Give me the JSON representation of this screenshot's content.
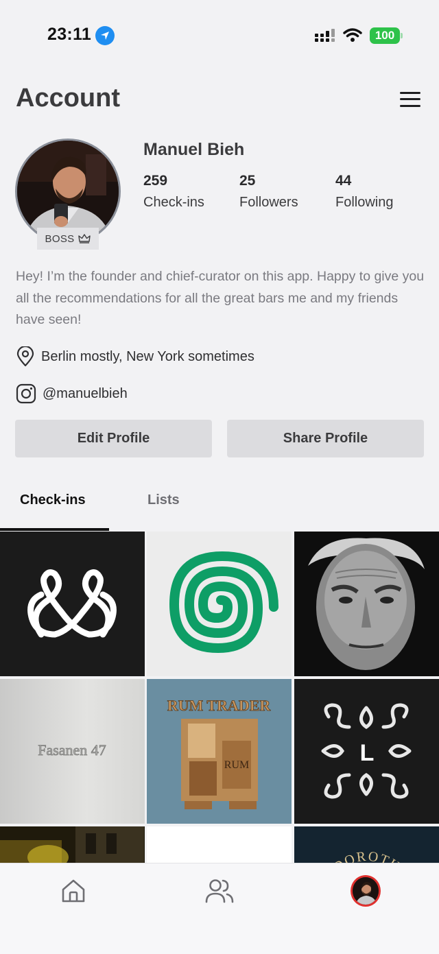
{
  "status_bar": {
    "time": "23:11",
    "battery": "100",
    "battery_color": "#2ec24a"
  },
  "header": {
    "title": "Account",
    "menu_icon": "hamburger-icon"
  },
  "profile": {
    "name": "Manuel Bieh",
    "badge": "BOSS",
    "badge_icon": "crown-icon",
    "stats": [
      {
        "value": "259",
        "label": "Check-ins"
      },
      {
        "value": "25",
        "label": "Followers"
      },
      {
        "value": "44",
        "label": "Following"
      }
    ],
    "bio": "Hey! I’m the founder and chief-curator on this app. Happy to give you all the recommendations for all the great bars me and my friends have seen!",
    "location": "Berlin mostly, New York sometimes",
    "location_icon": "map-pin-icon",
    "instagram": "@manuelbieh",
    "instagram_icon": "instagram-icon"
  },
  "actions": {
    "edit_label": "Edit Profile",
    "share_label": "Share Profile"
  },
  "tabs": [
    {
      "label": "Check-ins",
      "active": true
    },
    {
      "label": "Lists",
      "active": false
    }
  ],
  "grid": {
    "tiles": [
      {
        "name": "ampersand-logo"
      },
      {
        "name": "green-spiral-logo"
      },
      {
        "name": "portrait-photo"
      },
      {
        "name": "fasanen-47-sign",
        "text": "Fasanen 47"
      },
      {
        "name": "rum-trader-sign",
        "text": "RUM TRADER",
        "sub": "RUM"
      },
      {
        "name": "l-monogram-logo",
        "text": "L"
      },
      {
        "name": "street-photo"
      },
      {
        "name": "blank-tile"
      },
      {
        "name": "dorothy-logo",
        "text": "DOROTH"
      }
    ]
  },
  "bottom_nav": {
    "items": [
      {
        "icon": "home-icon"
      },
      {
        "icon": "friends-icon"
      },
      {
        "icon": "profile-avatar"
      }
    ],
    "active_color": "#e0312f"
  }
}
